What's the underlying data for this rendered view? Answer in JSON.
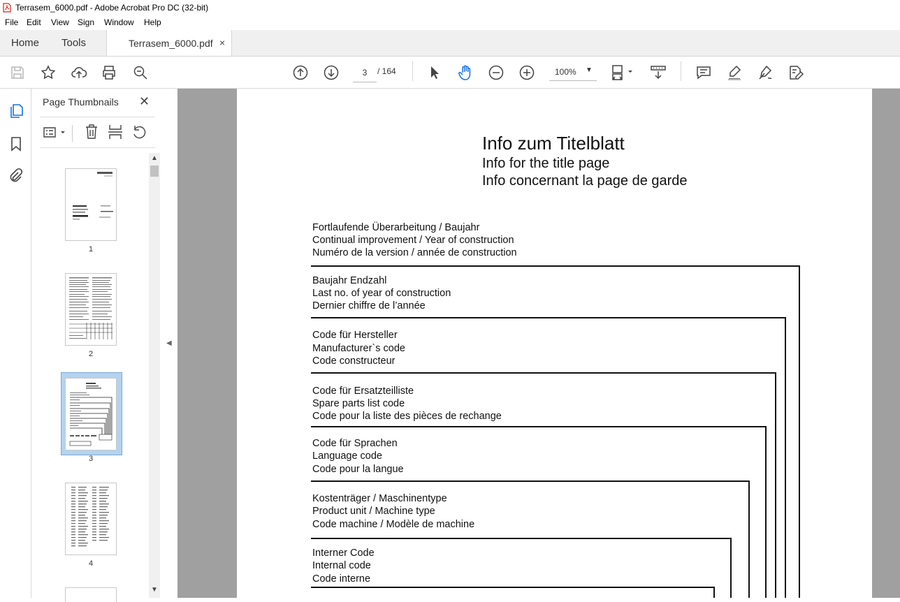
{
  "window": {
    "title": "Terrasem_6000.pdf - Adobe Acrobat Pro DC (32-bit)"
  },
  "menu": [
    "File",
    "Edit",
    "View",
    "Sign",
    "Window",
    "Help"
  ],
  "tabs": {
    "home": "Home",
    "tools": "Tools",
    "document": "Terrasem_6000.pdf",
    "close_glyph": "×"
  },
  "toolbar": {
    "page_current": "3",
    "page_total": "/ 164",
    "zoom": "100%"
  },
  "thumbnails": {
    "header": "Page Thumbnails",
    "close_glyph": "✕",
    "pages": [
      "1",
      "2",
      "3",
      "4"
    ],
    "selected": "3"
  },
  "document": {
    "title_de": "Info  zum  Titelblatt",
    "title_en": "Info for the title page",
    "title_fr": "Info concernant la page de garde",
    "sections": [
      [
        "Fortlaufende Überarbeitung / Baujahr",
        "Continual improvement / Year of construction",
        "Numéro de la version / année de construction"
      ],
      [
        "Baujahr Endzahl",
        "Last no. of year of construction",
        "Dernier chiffre de l’année"
      ],
      [
        "Code für Hersteller",
        "Manufacturer`s  code",
        "Code constructeur"
      ],
      [
        "Code für Ersatzteilliste",
        "Spare parts list code",
        "Code pour la liste des pièces de rechange"
      ],
      [
        "Code für Sprachen",
        "Language code",
        "Code pour la langue"
      ],
      [
        "Kostenträger / Maschinentype",
        "Product unit / Machine type",
        "Code machine / Modèle de machine"
      ],
      [
        "Interner Code",
        "Internal code",
        "Code interne"
      ]
    ]
  },
  "colors": {
    "accent": "#1473e6",
    "doc_background": "#a0a0a0",
    "thumb_selected": "#b4d3ee",
    "pdf_red": "#d7241c"
  }
}
